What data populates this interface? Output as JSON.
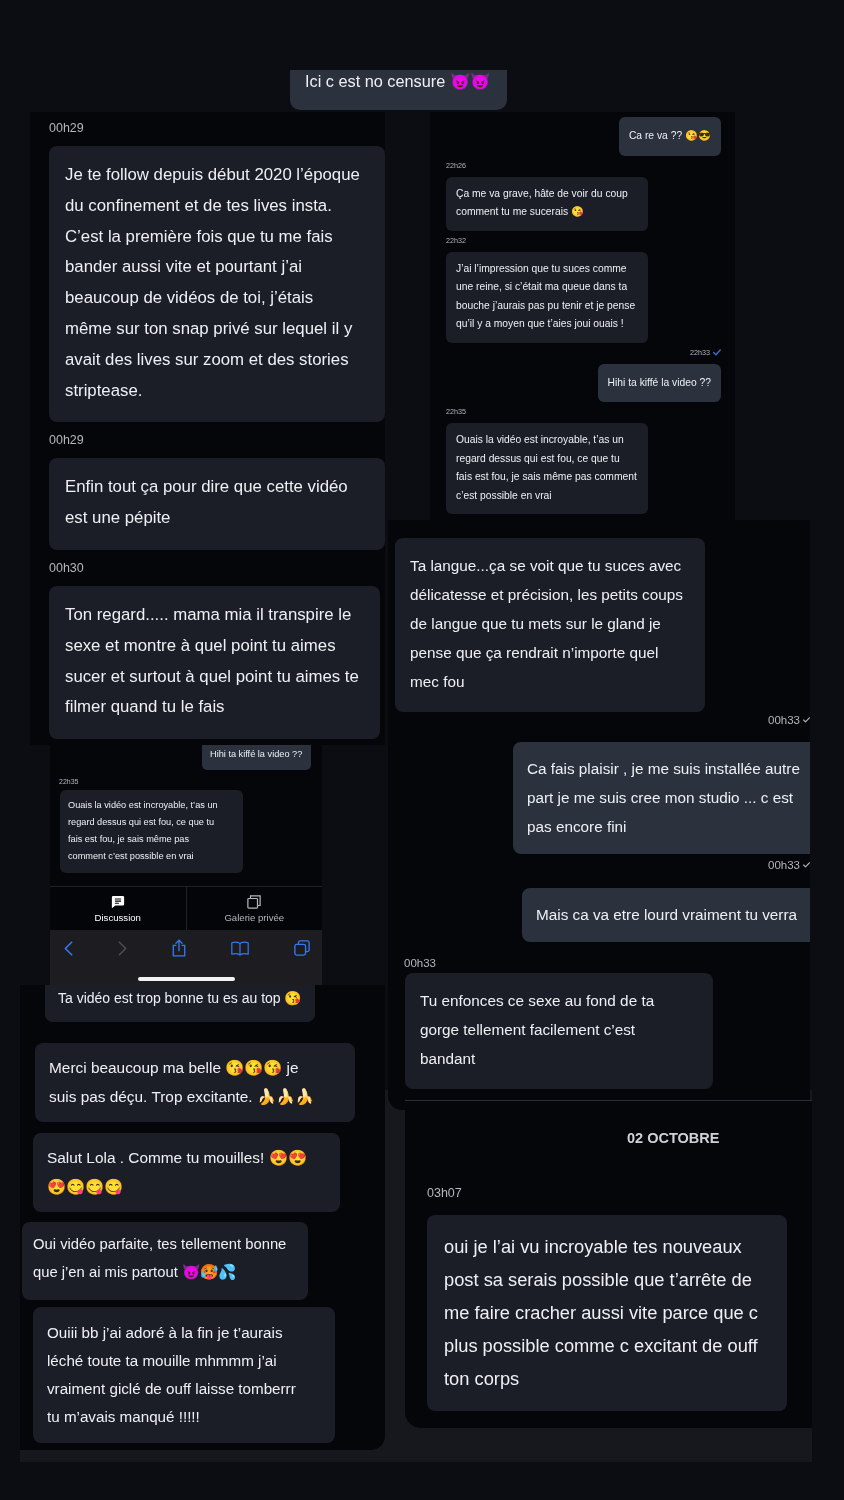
{
  "fragments": [
    {
      "kind": "chat",
      "messages": [
        {
          "kind": "sent",
          "text": "Ici c est no censure 😈😈"
        }
      ]
    },
    {
      "kind": "chat",
      "messages": [
        {
          "kind": "received",
          "time": "00h29",
          "text": "Je te follow depuis début 2020 l’époque du confinement et de tes lives insta. C’est la première fois que tu me fais bander aussi vite et pourtant j’ai beaucoup de vidéos de toi, j’étais même sur ton snap privé sur lequel il y avait des lives sur zoom et des stories striptease."
        },
        {
          "kind": "received",
          "time": "00h29",
          "text": "Enfin tout ça pour dire que cette vidéo est une pépite"
        },
        {
          "kind": "received",
          "time": "00h30",
          "text": "Ton regard..... mama mia il transpire le sexe et montre à quel point tu aimes sucer et surtout à quel point tu aimes te filmer quand tu le fais"
        }
      ]
    },
    {
      "kind": "chat",
      "messages": [
        {
          "kind": "sent",
          "text": "Ca re va ?? 😘😎"
        },
        {
          "kind": "received",
          "time": "22h26",
          "text": "Ça me va grave, hâte de voir du coup comment tu me sucerais 😘"
        },
        {
          "kind": "received",
          "time": "22h32",
          "text": "J’ai l’impression que tu suces comme une reine, si c’était ma queue dans ta bouche j’aurais pas pu tenir et je pense qu’il y a moyen que t’aies joui ouais !"
        },
        {
          "kind": "sent",
          "time": "22h33",
          "read": true,
          "text": "Hihi ta kiffé la video ??"
        },
        {
          "kind": "received",
          "time": "22h35",
          "text": "Ouais la vidéo est incroyable, t’as un regard dessus qui est fou, ce que tu fais est fou, je sais même pas comment c’est possible en vrai"
        }
      ]
    },
    {
      "kind": "chat",
      "messages": [
        {
          "kind": "received",
          "text": "Ta langue...ça se voit que tu suces avec délicatesse et précision, les petits coups de langue que tu mets sur le gland je pense que ça rendrait n’importe quel mec fou"
        },
        {
          "kind": "sent",
          "time": "00h33",
          "read": true,
          "text": "Ca fais plaisir , je me suis installée autre part je me suis cree mon studio ... c est pas encore fini"
        },
        {
          "kind": "sent",
          "time": "00h33",
          "read": true,
          "text": "Mais ca va etre lourd vraiment tu verra"
        },
        {
          "kind": "received",
          "time": "00h33",
          "text": "Tu enfonces ce sexe au fond de ta gorge tellement facilement c’est bandant"
        }
      ]
    },
    {
      "kind": "app",
      "messages": [
        {
          "kind": "sent",
          "text": "Hihi ta kiffé la video ??"
        },
        {
          "kind": "received",
          "time": "22h35",
          "text": "Ouais la vidéo est incroyable, t’as un regard dessus qui est fou, ce que tu fais est fou, je sais même pas comment c’est possible en vrai"
        }
      ],
      "tabs": [
        {
          "kind": "chat",
          "label": "Discussion",
          "selected": true
        },
        {
          "kind": "gallery",
          "label": "Galerie privée",
          "selected": false
        }
      ],
      "toolbar": [
        {
          "kind": "back",
          "disabled": false
        },
        {
          "kind": "forward",
          "disabled": true
        },
        {
          "kind": "share",
          "disabled": false
        },
        {
          "kind": "bookmarks",
          "disabled": false
        },
        {
          "kind": "tabs",
          "disabled": false
        }
      ]
    },
    {
      "kind": "chat",
      "messages": [
        {
          "kind": "received",
          "text": "Ta vidéo est trop bonne tu es au top 😘"
        },
        {
          "kind": "received",
          "text": "Merci beaucoup ma belle 😘😘😘 je suis pas déçu. Trop excitante. 🍌🍌🍌"
        },
        {
          "kind": "received",
          "text": "Salut Lola . Comme tu mouilles! 😍😍😍😋😋😋"
        },
        {
          "kind": "received",
          "text": "Oui vidéo parfaite, tes tellement bonne que j’en ai mis partout 😈🥵💦"
        },
        {
          "kind": "received",
          "text": "Ouiii bb j’ai adoré à la fin je t’aurais léché toute ta mouille mhmmm j’ai vraiment giclé de ouff laisse tomberrr tu m’avais manqué !!!!!"
        }
      ]
    },
    {
      "kind": "chat",
      "date": "02 OCTOBRE",
      "messages": [
        {
          "kind": "received",
          "time": "03h07",
          "text": "oui je l’ai vu incroyable tes nouveaux post sa serais possible que t’arrête de me faire cracher aussi vite parce que c plus possible comme c excitant de ouff ton corps"
        }
      ]
    }
  ]
}
